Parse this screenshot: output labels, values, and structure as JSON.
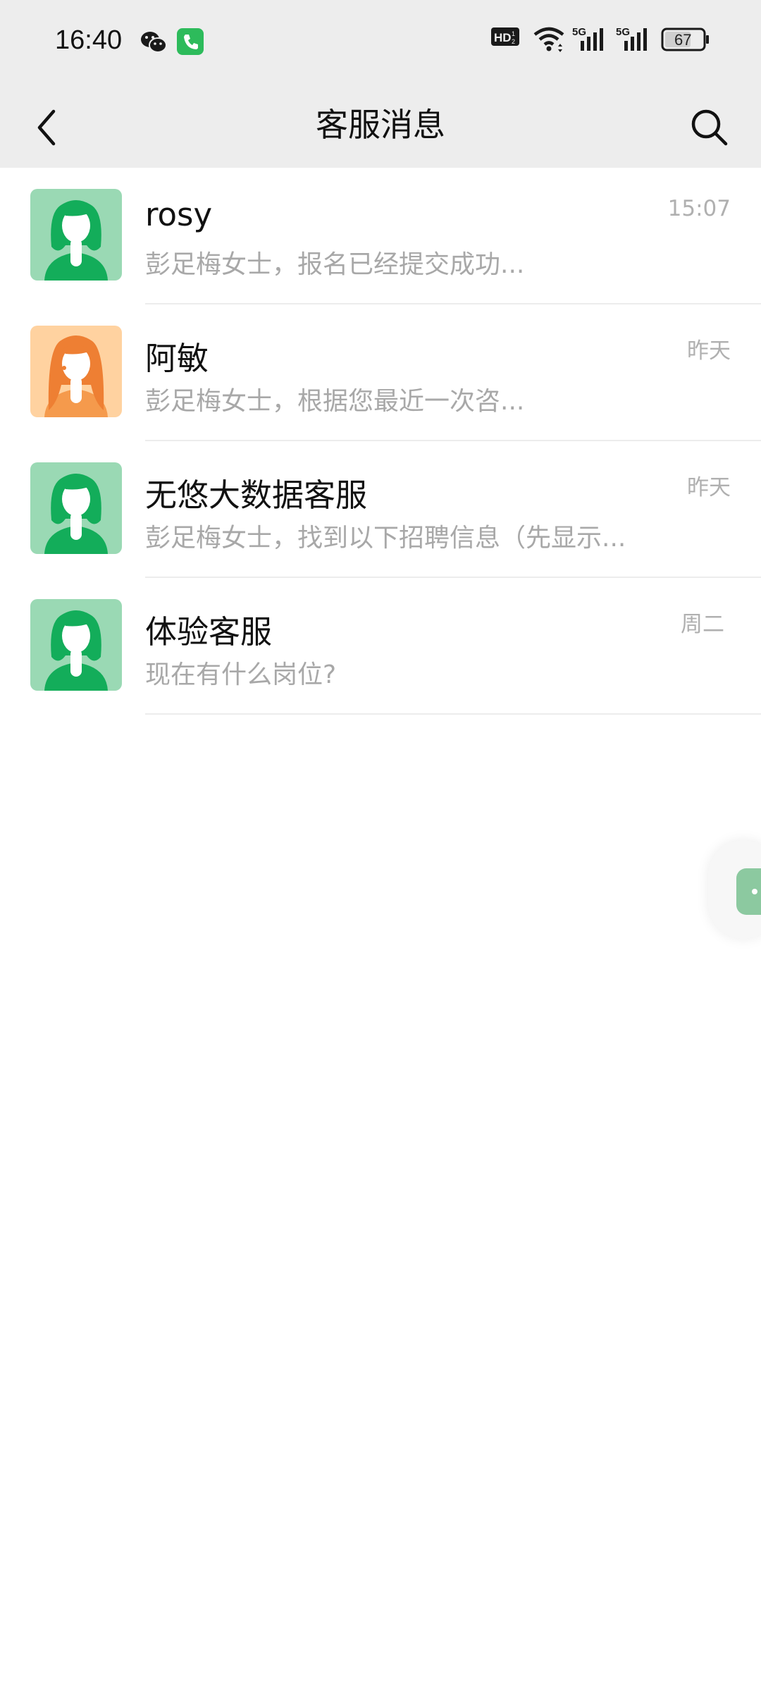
{
  "status_bar": {
    "time": "16:40",
    "app_icons": [
      "wechat-icon",
      "phone-call-icon"
    ],
    "indicators": [
      "hd-voice-icon",
      "wifi-icon",
      "5g-signal-icon",
      "5g-signal-icon"
    ],
    "battery": "67"
  },
  "header": {
    "title": "客服消息",
    "back_icon": "chevron-left-icon",
    "search_icon": "search-icon"
  },
  "chats": [
    {
      "name": "rosy",
      "preview": "彭足梅女士，报名已经提交成功...",
      "time": "15:07",
      "avatar": "green-agent-avatar"
    },
    {
      "name": "阿敏",
      "preview": "彭足梅女士，根据您最近一次咨...",
      "time": "昨天",
      "avatar": "orange-agent-avatar"
    },
    {
      "name": "无悠大数据客服",
      "preview": "彭足梅女士，找到以下招聘信息（先显示...",
      "time": "昨天",
      "avatar": "green-agent-avatar"
    },
    {
      "name": "体验客服",
      "preview": "现在有什么岗位?",
      "time": "周二",
      "avatar": "green-agent-avatar"
    }
  ],
  "colors": {
    "header_bg": "#ededed",
    "green_avatar_bg": "#9ad9b4",
    "green_agent": "#13ad5a",
    "orange_avatar_bg": "#ffd2a0",
    "orange_hair": "#ee7f33",
    "orange_body": "#f59a4c"
  }
}
